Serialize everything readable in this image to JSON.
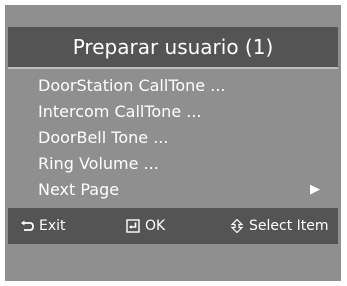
{
  "title": "Preparar usuario (1)",
  "menu": {
    "items": [
      {
        "label": "DoorStation CallTone ..."
      },
      {
        "label": "Intercom CallTone ..."
      },
      {
        "label": "DoorBell Tone ..."
      },
      {
        "label": "Ring Volume ..."
      },
      {
        "label": "Next Page"
      }
    ],
    "next_page_arrow": "▶"
  },
  "footer": {
    "exit_label": "Exit",
    "ok_label": "OK",
    "select_label": "Select Item"
  },
  "icons": {
    "exit": "return-arrow-icon",
    "ok": "enter-key-icon",
    "select": "up-down-arrow-icon"
  },
  "colors": {
    "screen_background": "#8f8f8f",
    "bar_background": "#545454",
    "text": "#ffffff"
  }
}
